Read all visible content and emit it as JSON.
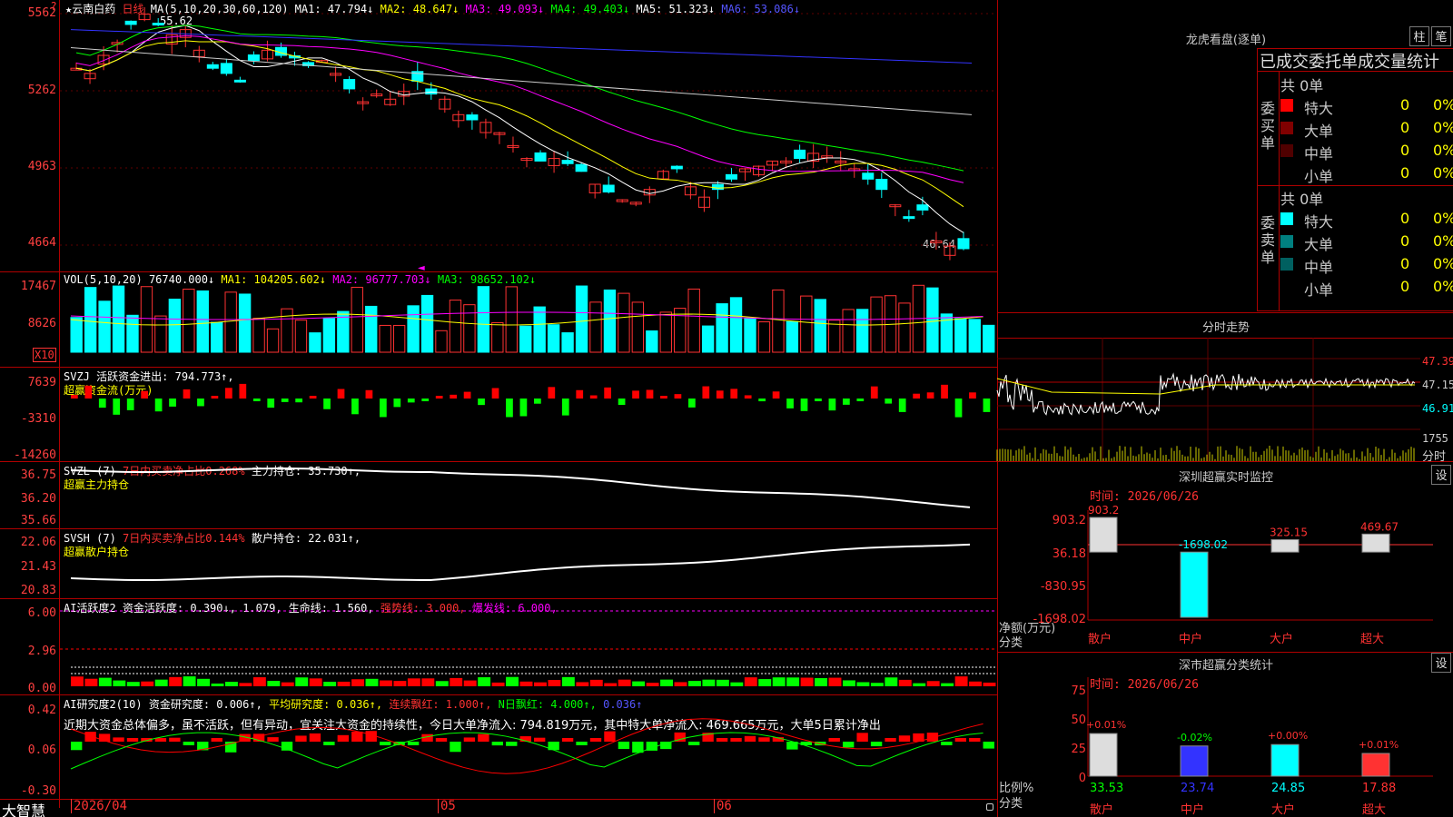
{
  "stock": {
    "name": "★云南白药",
    "period": "日线"
  },
  "main": {
    "label": "MA(5,10,20,30,60,120)",
    "ma1": "MA1: 47.794↓",
    "ma2": "MA2: 48.647↓",
    "ma3": "MA3: 49.093↓",
    "ma4": "MA4: 49.403↓",
    "ma5": "MA5: 51.323↓",
    "ma6": "MA6: 53.086↓",
    "ticks": [
      "5562",
      "5262",
      "4963",
      "4664"
    ],
    "high_label": "55.62",
    "low_label": "46.64"
  },
  "vol": {
    "label": "VOL(5,10,20)",
    "val": "76740.000↓",
    "ma1": "MA1: 104205.602↓",
    "ma2": "MA2: 96777.703↓",
    "ma3": "MA3: 98652.102↓",
    "ticks": [
      "17467",
      "8626"
    ],
    "unit": "X10"
  },
  "svzj": {
    "label": "SVZJ",
    "text": "活跃资金进出: 794.773↑,",
    "sub": "超赢资金流(万元)",
    "ticks": [
      "7639",
      "-3310",
      "-14260"
    ]
  },
  "svzl": {
    "label": "SVZL (7)",
    "text1": "7日内买卖净占比0.268%",
    "text2": "主力持仓: 35.730↑,",
    "sub": "超赢主力持仓",
    "ticks": [
      "36.75",
      "36.20",
      "35.66"
    ]
  },
  "svsh": {
    "label": "SVSH (7)",
    "text1": "7日内买卖净占比0.144%",
    "text2": "散户持仓: 22.031↑,",
    "sub": "超赢散户持仓",
    "ticks": [
      "22.06",
      "21.43",
      "20.83"
    ]
  },
  "ai2": {
    "label": "AI活跃度2",
    "t1": "资金活跃度: 0.390↓,",
    "t2": "1.079,",
    "t3": "生命线: 1.560,",
    "t4": "强势线: 3.000,",
    "t5": "爆发线: 6.000,",
    "ticks": [
      "6.00",
      "2.96",
      "0.00"
    ]
  },
  "ai_res": {
    "label": "AI研究度2(10)",
    "t1": "资金研究度: 0.006↑,",
    "t2": "平均研究度: 0.036↑,",
    "t3": "连续飘红: 1.000↑,",
    "t4": "N日飘红: 4.000↑,",
    "t5": "0.036↑",
    "comment": "近期大资金总体偏多，虽不活跃，但有异动，宜关注大资金的持续性，今日大单净流入: 794.819万元，其中特大单净流入: 469.665万元，大单5日累计净出",
    "ticks": [
      "0.42",
      "0.06",
      "-0.30"
    ]
  },
  "xaxis": {
    "d1": "2026/04",
    "d2": "05",
    "d3": "06"
  },
  "footer": {
    "brand": "大智慧"
  },
  "dragon": {
    "title": "龙虎看盘(逐单)",
    "btn1": "柱",
    "btn2": "笔",
    "subtitle": "已成交委托单成交量统计",
    "buy_label": "委买单",
    "sell_label": "委卖单",
    "buy_total": "共 0单",
    "sell_total": "共 0单",
    "buy_rows": [
      {
        "name": "特大",
        "v": "0",
        "p": "0%"
      },
      {
        "name": "大单",
        "v": "0",
        "p": "0%"
      },
      {
        "name": "中单",
        "v": "0",
        "p": "0%"
      },
      {
        "name": "小单",
        "v": "0",
        "p": "0%"
      }
    ],
    "sell_rows": [
      {
        "name": "特大",
        "v": "0",
        "p": "0%"
      },
      {
        "name": "大单",
        "v": "0",
        "p": "0%"
      },
      {
        "name": "中单",
        "v": "0",
        "p": "0%"
      },
      {
        "name": "小单",
        "v": "0",
        "p": "0%"
      }
    ]
  },
  "intraday": {
    "title": "分时走势",
    "prices": [
      "47.39",
      "47.15",
      "46.91"
    ],
    "vol": "1755",
    "unit": "分时"
  },
  "szmon": {
    "title": "深圳超赢实时监控",
    "btn": "设",
    "time": "时间: 2026/06/26",
    "ticks": [
      "903.2",
      "36.18",
      "-830.95",
      "-1698.02"
    ],
    "ylabel": "净额(万元)",
    "xlabel": "分类",
    "values": [
      "903.2",
      "-1698.02",
      "325.15",
      "469.67"
    ],
    "cats": [
      "散户",
      "中户",
      "大户",
      "超大"
    ]
  },
  "szcls": {
    "title": "深市超赢分类统计",
    "btn": "设",
    "time": "时间: 2026/06/26",
    "ticks": [
      "75",
      "50",
      "25",
      "0"
    ],
    "ylabel": "比例%",
    "xlabel": "分类",
    "pcts": [
      "+0.01%",
      "-0.02%",
      "+0.00%",
      "+0.01%"
    ],
    "values": [
      "33.53",
      "23.74",
      "24.85",
      "17.88"
    ],
    "cats": [
      "散户",
      "中户",
      "大户",
      "超大"
    ]
  }
}
